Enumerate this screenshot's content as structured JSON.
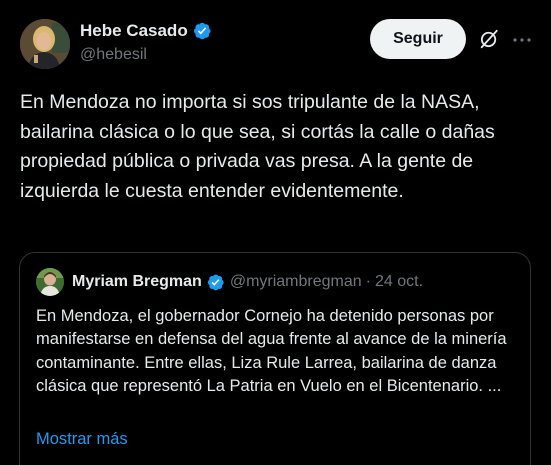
{
  "post": {
    "author": {
      "display_name": "Hebe Casado",
      "handle": "@hebesil",
      "verified": true
    },
    "follow_label": "Seguir",
    "text": "En Mendoza no importa si sos tripulante de la NASA, bailarina clásica o lo que sea, si cortás la calle o dañas propiedad pública o privada vas presa. A la gente de izquierda le cuesta entender evidentemente."
  },
  "quote": {
    "author": {
      "display_name": "Myriam Bregman",
      "handle": "@myriambregman",
      "verified": true
    },
    "separator": "·",
    "date": "24 oct.",
    "text": "En Mendoza, el gobernador Cornejo ha detenido personas por manifestarse en defensa del agua frente al avance de la minería contaminante. Entre ellas, Liza Rule Larrea, bailarina de danza clásica que representó La Patria en Vuelo en el Bicentenario. ...",
    "show_more_label": "Mostrar más"
  },
  "icons": {
    "verified": "verified-badge-icon",
    "grok": "grok-icon",
    "more": "more-options-icon"
  },
  "colors": {
    "background": "#000000",
    "text_primary": "#e7e9ea",
    "text_secondary": "#71767b",
    "accent_link": "#1d9bf0",
    "verified_badge": "#1d9bf0",
    "follow_button_bg": "#eff3f4",
    "follow_button_text": "#0f1419",
    "border": "#2f3336"
  }
}
